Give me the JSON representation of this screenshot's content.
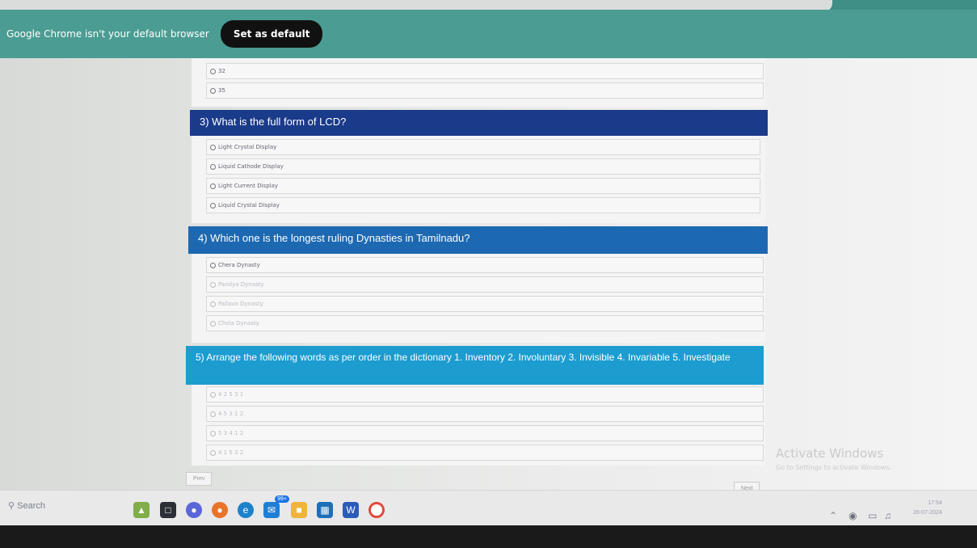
{
  "notification": {
    "message": "Google Chrome isn't your default browser",
    "button_label": "Set as default"
  },
  "quiz": {
    "q2_tail_options": [
      "32",
      "35"
    ],
    "questions": [
      {
        "number_title": "3)  What is the full form of LCD?",
        "options": [
          "Light Crystal Display",
          "Liquid Cathode Display",
          "Light Current Display",
          "Liquid Crystal Display"
        ]
      },
      {
        "number_title": "4)  Which one is the longest ruling Dynasties in Tamilnadu?",
        "options": [
          "Chera Dynasty",
          "Pandya Dynasty",
          "Pallava Dynasty",
          "Chola Dynasty"
        ]
      },
      {
        "number_title": "5)  Arrange the following words as per order in the dictionary 1. Inventory 2. Involuntary 3. Invisible 4. Invariable 5. Investigate",
        "options": [
          "4 2 5 3 1",
          "4 5 3 1 2",
          "5 3 4 1 2",
          "4 1 5 3 2"
        ]
      }
    ],
    "prev_label": "Prev",
    "next_label": "Next"
  },
  "watermark": {
    "title": "Activate Windows",
    "subtitle": "Go to Settings to activate Windows."
  },
  "taskbar": {
    "search_placeholder": "Search",
    "mail_badge": "99+",
    "time": "17:54",
    "date": "26-07-2024"
  },
  "colors": {
    "notify_bar": "#4b9c92",
    "q3_header": "#1a3a8a",
    "q4_header": "#1d69b1",
    "q5_header": "#1c9ccf"
  }
}
